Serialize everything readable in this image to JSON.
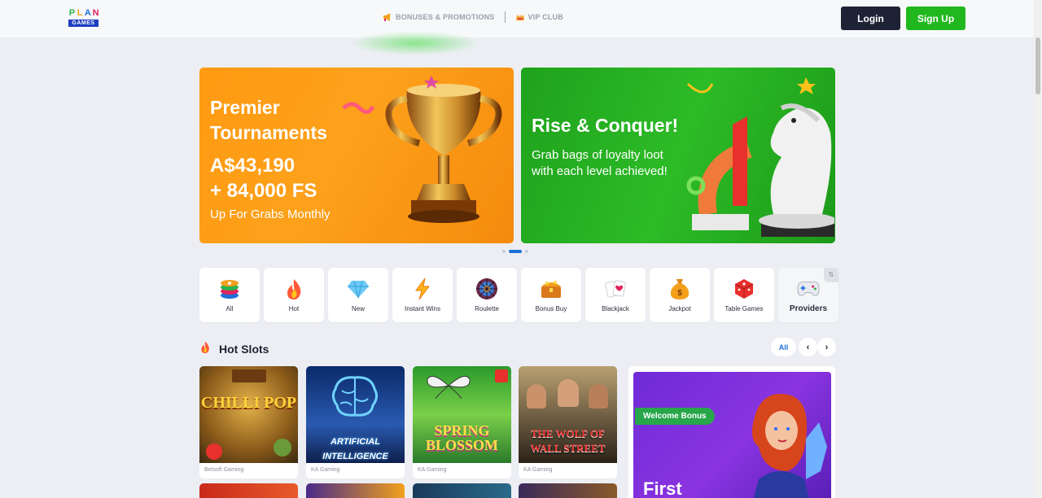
{
  "header": {
    "logo_letters": [
      "P",
      "L",
      "A",
      "N"
    ],
    "logo_sub": "GAMES",
    "nav": [
      {
        "label": "BONUSES & PROMOTIONS",
        "icon": "megaphone-icon"
      },
      {
        "label": "VIP CLUB",
        "icon": "crown-icon"
      }
    ],
    "login": "Login",
    "signup": "Sign Up"
  },
  "colors": {
    "login_bg": "#1e2235",
    "signup_bg": "#20b81e",
    "accent_blue": "#1e6fd9",
    "banner_orange": "#ff9a12",
    "banner_green": "#2dbb27",
    "promo_purple": "#7a2fdc"
  },
  "banners": [
    {
      "title_line1": "Premier",
      "title_line2": "Tournaments",
      "amount_line1": "A$43,190",
      "amount_line2": "+ 84,000 FS",
      "subtitle": "Up For Grabs Monthly"
    },
    {
      "title": "Rise & Conquer!",
      "subtitle": "Grab bags of loyalty loot with each level achieved!"
    }
  ],
  "carousel": {
    "count": 3,
    "active": 2
  },
  "categories": [
    {
      "label": "All",
      "icon": "chips-icon"
    },
    {
      "label": "Hot",
      "icon": "flame-icon"
    },
    {
      "label": "New",
      "icon": "diamond-icon"
    },
    {
      "label": "Instant Wins",
      "icon": "lightning-icon"
    },
    {
      "label": "Roulette",
      "icon": "roulette-icon"
    },
    {
      "label": "Bonus Buy",
      "icon": "treasure-chest-icon"
    },
    {
      "label": "Blackjack",
      "icon": "playing-cards-icon"
    },
    {
      "label": "Jackpot",
      "icon": "money-bag-icon"
    },
    {
      "label": "Table Games",
      "icon": "dice-icon"
    },
    {
      "label": "Providers",
      "icon": "gamepad-icon"
    }
  ],
  "hot_slots": {
    "title": "Hot Slots",
    "all_label": "All",
    "games": [
      {
        "name": "CHILLI POP",
        "provider": "Betsoft Gaming"
      },
      {
        "name": "ARTIFICIAL INTELLIGENCE",
        "provider": "KA Gaming"
      },
      {
        "name": "SPRING BLOSSOM",
        "provider": "KA Gaming"
      },
      {
        "name": "THE WOLF OF WALL STREET",
        "provider": "KA Gaming"
      }
    ]
  },
  "promo": {
    "badge": "Welcome Bonus",
    "headline": "First"
  }
}
